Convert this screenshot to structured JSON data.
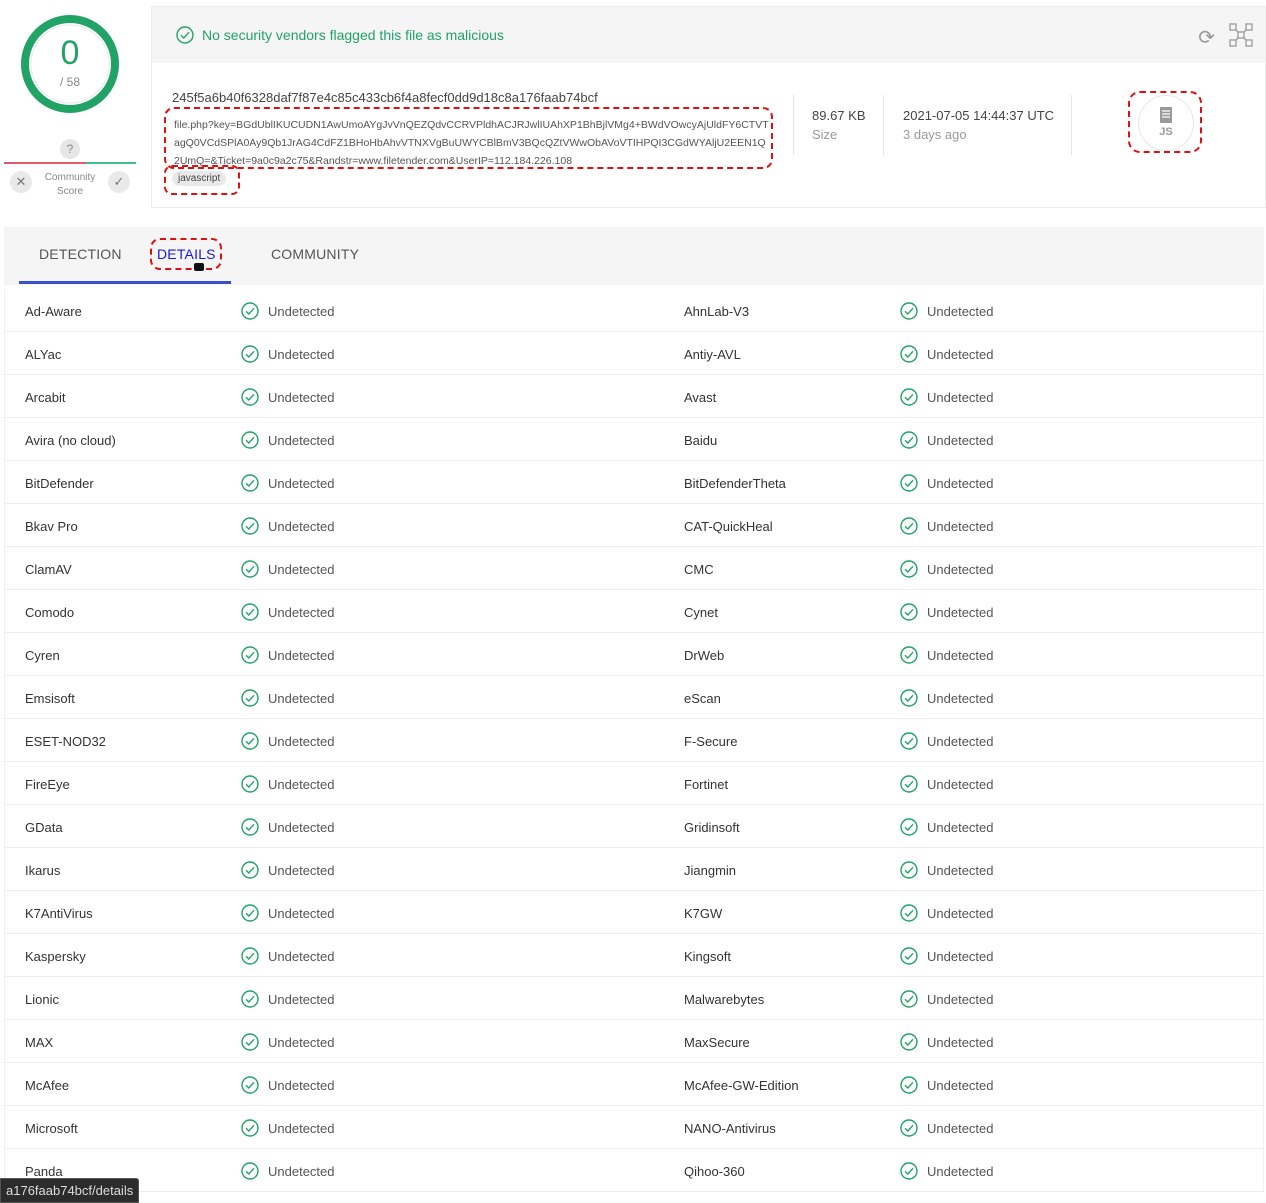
{
  "score": {
    "detections": "0",
    "total": "/ 58",
    "ratio": 0.0,
    "accent": "#21a366"
  },
  "community": {
    "question": "?",
    "label": "Community Score",
    "down_glyph": "✕",
    "up_glyph": "✓"
  },
  "banner": {
    "message": "No security vendors flagged this file as malicious",
    "icons": [
      "check-circle-icon",
      "refresh-icon",
      "graph-icon"
    ]
  },
  "file": {
    "hash": "245f5a6b40f6328daf7f87e4c85c433cb6f4a8fecf0dd9d18c8a176faab74bcf",
    "name": "file.php?key=BGdUblIKUCUDN1AwUmoAYgJvVnQEZQdvCCRVPldhACJRJwlIUAhXP1BhBjlVMg4+BWdVOwcyAjUldFY6CTVTagQ0VCdSPlA0Ay9Qb1JrAG4CdFZ1BHoHbAhvVTNXVgBuUWYCBlBmV3BQcQZtVWwObAVoVTIHPQI3CGdWYAljU2EEN1Q2UmQ=&Ticket=9a0c9a2c75&Randstr=www.filetender.com&UserIP=112.184.226.108",
    "tag": "javascript",
    "size": "89.67 KB",
    "size_label": "Size",
    "date": "2021-07-05 14:44:37 UTC",
    "date_ago": "3 days ago",
    "type_label": "JS"
  },
  "tabs": [
    {
      "label": "DETECTION",
      "active": false
    },
    {
      "label": "DETAILS",
      "active": true
    },
    {
      "label": "COMMUNITY",
      "active": false
    }
  ],
  "result_label": "Undetected",
  "vendors": [
    [
      "Ad-Aware",
      "AhnLab-V3"
    ],
    [
      "ALYac",
      "Antiy-AVL"
    ],
    [
      "Arcabit",
      "Avast"
    ],
    [
      "Avira (no cloud)",
      "Baidu"
    ],
    [
      "BitDefender",
      "BitDefenderTheta"
    ],
    [
      "Bkav Pro",
      "CAT-QuickHeal"
    ],
    [
      "ClamAV",
      "CMC"
    ],
    [
      "Comodo",
      "Cynet"
    ],
    [
      "Cyren",
      "DrWeb"
    ],
    [
      "Emsisoft",
      "eScan"
    ],
    [
      "ESET-NOD32",
      "F-Secure"
    ],
    [
      "FireEye",
      "Fortinet"
    ],
    [
      "GData",
      "Gridinsoft"
    ],
    [
      "Ikarus",
      "Jiangmin"
    ],
    [
      "K7AntiVirus",
      "K7GW"
    ],
    [
      "Kaspersky",
      "Kingsoft"
    ],
    [
      "Lionic",
      "Malwarebytes"
    ],
    [
      "MAX",
      "MaxSecure"
    ],
    [
      "McAfee",
      "McAfee-GW-Edition"
    ],
    [
      "Microsoft",
      "NANO-Antivirus"
    ],
    [
      "Panda",
      "Qihoo-360"
    ]
  ],
  "status_url": "a176faab74bcf/details"
}
